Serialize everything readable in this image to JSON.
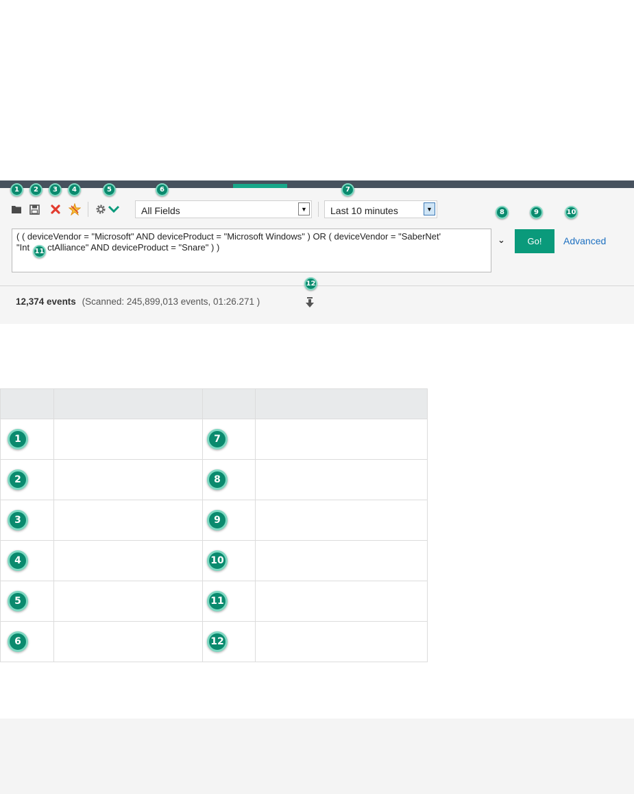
{
  "toolbar": {
    "icons": [
      "folder-open-icon",
      "save-icon",
      "delete-icon",
      "new-filter-icon",
      "gear-icon",
      "chevron-down-icon"
    ],
    "colors": {
      "accent": "#0a9a7b",
      "header": "#47525e",
      "delete": "#e23b2e",
      "star": "#f2a01b"
    }
  },
  "fields_select": {
    "value": "All Fields"
  },
  "time_select": {
    "value": "Last 10 minutes"
  },
  "query": {
    "line1": "( ( deviceVendor = \"Microsoft\" AND deviceProduct = \"Microsoft Windows\" )  OR  ( deviceVendor = \"SaberNet'",
    "line2_a": "\"Int",
    "line2_b": "ctAlliance\" AND deviceProduct = \"Snare\" ) )"
  },
  "go_button": {
    "label": "Go!"
  },
  "advanced_link": {
    "label": "Advanced"
  },
  "status": {
    "events": "12,374 events",
    "scanned": "(Scanned: 245,899,013 events,  01:26.271 )"
  },
  "callouts": [
    "1",
    "2",
    "3",
    "4",
    "5",
    "6",
    "7",
    "8",
    "9",
    "10",
    "11",
    "12"
  ],
  "legend": {
    "rows": [
      {
        "left": "1",
        "right": "7"
      },
      {
        "left": "2",
        "right": "8"
      },
      {
        "left": "3",
        "right": "9"
      },
      {
        "left": "4",
        "right": "10"
      },
      {
        "left": "5",
        "right": "11"
      },
      {
        "left": "6",
        "right": "12"
      }
    ]
  }
}
